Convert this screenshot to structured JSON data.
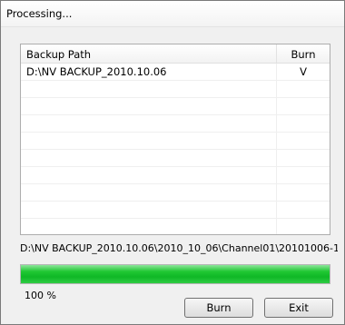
{
  "window": {
    "title": "Processing..."
  },
  "list": {
    "columns": [
      "Backup Path",
      "Burn"
    ],
    "rows": [
      {
        "path": "D:\\NV BACKUP_2010.10.06",
        "burn": "V"
      },
      {
        "path": "",
        "burn": ""
      },
      {
        "path": "",
        "burn": ""
      },
      {
        "path": "",
        "burn": ""
      },
      {
        "path": "",
        "burn": ""
      },
      {
        "path": "",
        "burn": ""
      },
      {
        "path": "",
        "burn": ""
      },
      {
        "path": "",
        "burn": ""
      },
      {
        "path": "",
        "burn": ""
      },
      {
        "path": "",
        "burn": ""
      }
    ]
  },
  "current_path": "D:\\NV BACKUP_2010.10.06\\2010_10_06\\Channel01\\20101006-1",
  "progress": {
    "percent_value": 100,
    "percent_label": "100  %",
    "color": "#20c833"
  },
  "buttons": {
    "burn_label": "Burn",
    "exit_label": "Exit"
  }
}
